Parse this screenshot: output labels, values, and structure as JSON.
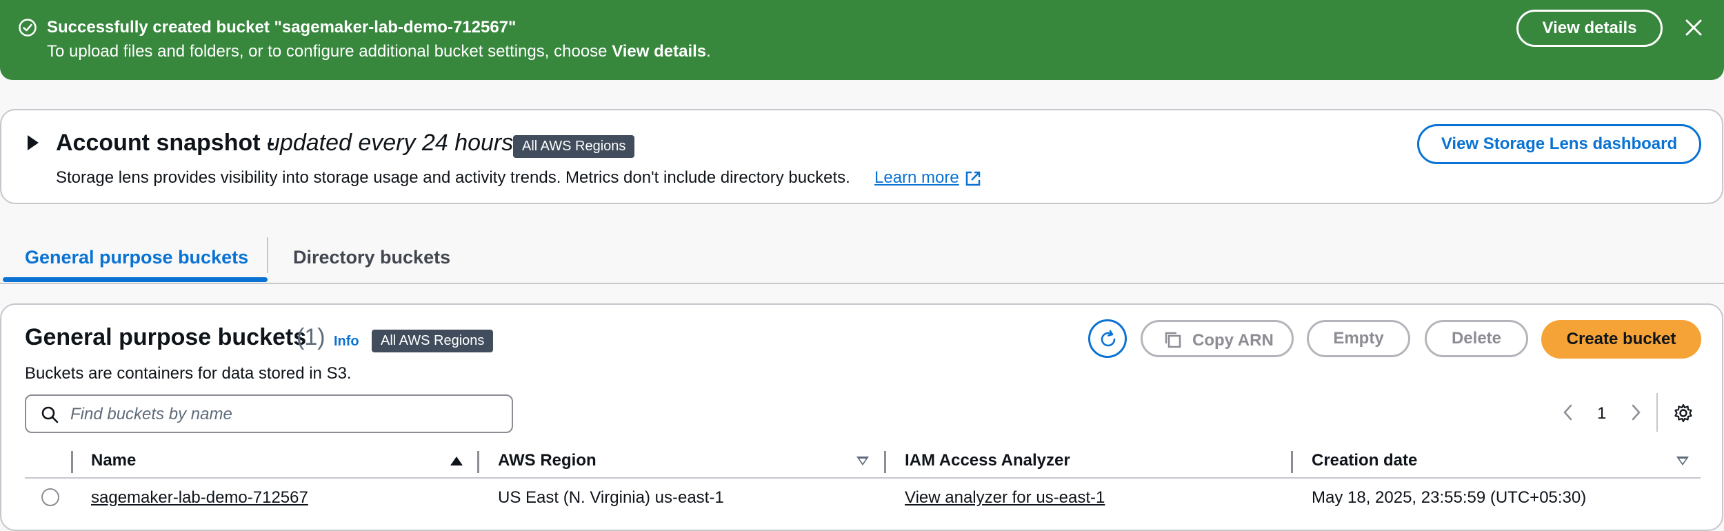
{
  "flash": {
    "title": "Successfully created bucket \"sagemaker-lab-demo-712567\"",
    "message_prefix": "To upload files and folders, or to configure additional bucket settings, choose ",
    "message_bold": "View details",
    "message_suffix": ".",
    "view_details_label": "View details",
    "color": "#37873d"
  },
  "snapshot": {
    "heading": "Account snapshot -",
    "heading_sub": "updated every 24 hours",
    "badge": "All AWS Regions",
    "description": "Storage lens provides visibility into storage usage and activity trends. Metrics don't include directory buckets.",
    "learn_more": "Learn more",
    "lens_button": "View Storage Lens dashboard"
  },
  "tabs": [
    {
      "label": "General purpose buckets",
      "active": true
    },
    {
      "label": "Directory buckets",
      "active": false
    }
  ],
  "panel": {
    "title": "General purpose buckets",
    "count": "(1)",
    "info": "Info",
    "badge": "All AWS Regions",
    "description": "Buckets are containers for data stored in S3.",
    "copy_arn": "Copy ARN",
    "empty": "Empty",
    "delete": "Delete",
    "create": "Create bucket",
    "create_color": "#f5a337",
    "search_placeholder": "Find buckets by name",
    "page": "1"
  },
  "table": {
    "columns": [
      "Name",
      "AWS Region",
      "IAM Access Analyzer",
      "Creation date"
    ],
    "rows": [
      {
        "name": "sagemaker-lab-demo-712567",
        "region": "US East (N. Virginia) us-east-1",
        "analyzer": "View analyzer for us-east-1",
        "created": "May 18, 2025, 23:55:59 (UTC+05:30)"
      }
    ]
  },
  "accent": "#0972d3"
}
